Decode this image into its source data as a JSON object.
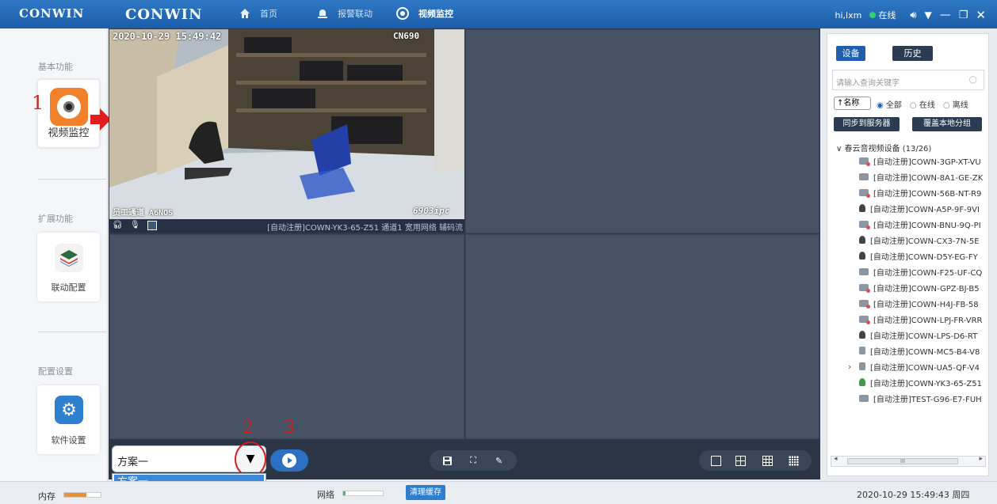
{
  "app": {
    "logo_left": "CONWIN",
    "logo_main": "CONWIN"
  },
  "nav": [
    {
      "label": "首页",
      "icon": "home-icon"
    },
    {
      "label": "报警联动",
      "icon": "alarm-bell-icon"
    },
    {
      "label": "视频监控",
      "icon": "video-monitor-icon"
    }
  ],
  "user": {
    "name": "hi,lxm",
    "status": "在线"
  },
  "left": {
    "sections": [
      "基本功能",
      "扩展功能",
      "配置设置"
    ],
    "tiles": [
      "视频监控",
      "联动配置",
      "软件设置"
    ]
  },
  "video": {
    "timestamp": "2020-10-29  15:49:42",
    "device_osd": "CN690",
    "bottom_left_osd": "员工通道 A6NOS",
    "model_osd": "6903ipc",
    "channel_info": "[自动注册]COWN-YK3-65-Z51 通道1 宽用网络 辅码流"
  },
  "annotations": {
    "n1": "1",
    "n2": "2",
    "n3": "3"
  },
  "scheme": {
    "selected": "方案一",
    "options": [
      "方案一"
    ]
  },
  "right": {
    "tab_device": "设备",
    "tab_history": "历史",
    "search_placeholder": "请输入查询关键字",
    "sort_label": "↑名称",
    "filters": [
      "全部",
      "在线",
      "离线"
    ],
    "btn_sync": "同步到服务器",
    "btn_cover": "覆盖本地分组",
    "group_label": "春云音视频设备 (13/26)",
    "devices": [
      "[自动注册]COWN-3GP-XT-VU",
      "[自动注册]COWN-8A1-GE-ZK",
      "[自动注册]COWN-56B-NT-R9",
      "[自动注册]COWN-A5P-9F-9VI",
      "[自动注册]COWN-BNU-9Q-PI",
      "[自动注册]COWN-CX3-7N-5E",
      "[自动注册]COWN-D5Y-EG-FY",
      "[自动注册]COWN-F25-UF-CQ",
      "[自动注册]COWN-GPZ-BJ-B5",
      "[自动注册]COWN-H4J-FB-58",
      "[自动注册]COWN-LPJ-FR-VRR",
      "[自动注册]COWN-LPS-D6-RT",
      "[自动注册]COWN-MC5-B4-V8",
      "[自动注册]COWN-UA5-QF-V4",
      "[自动注册]COWN-YK3-65-Z51",
      "[自动注册]TEST-G96-E7-FUH"
    ],
    "scroll_grip": "III"
  },
  "status": {
    "memory_label": "内存",
    "network_label": "网络",
    "clear_cache": "清理缓存",
    "datetime": "2020-10-29 15:49:43 周四"
  }
}
